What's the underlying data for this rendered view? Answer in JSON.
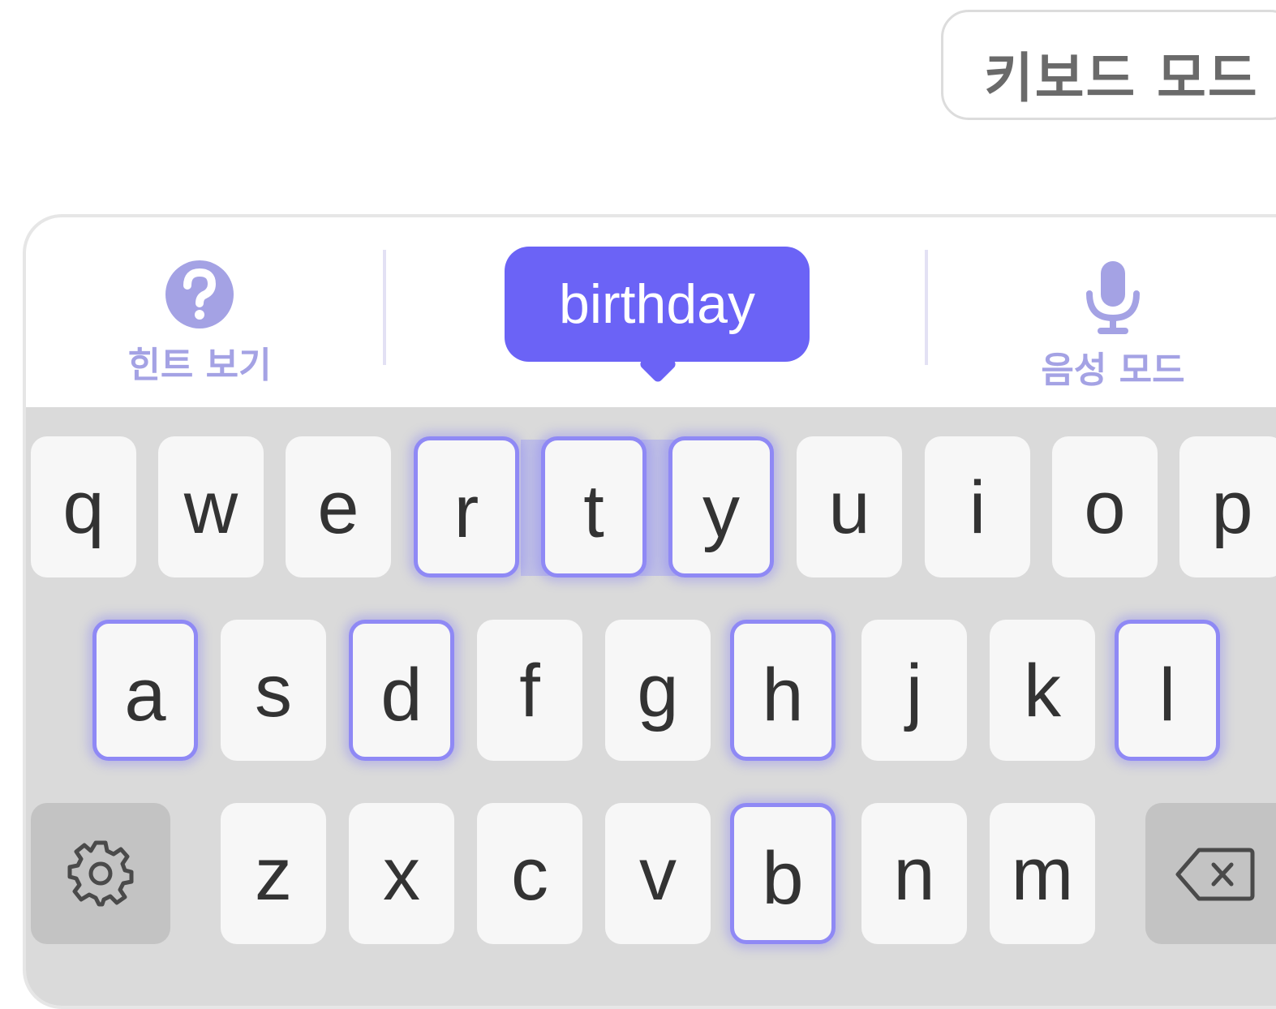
{
  "mode_button": {
    "label": "키보드 모드"
  },
  "toolbar": {
    "hint_label": "힌트 보기",
    "voice_label": "음성 모드",
    "suggestion": "birthday"
  },
  "keyboard": {
    "row1": [
      "q",
      "w",
      "e",
      "r",
      "t",
      "y",
      "u",
      "i",
      "o",
      "p"
    ],
    "row2": [
      "a",
      "s",
      "d",
      "f",
      "g",
      "h",
      "j",
      "k",
      "l"
    ],
    "row3": [
      "z",
      "x",
      "c",
      "v",
      "b",
      "n",
      "m"
    ],
    "highlighted_keys": [
      "r",
      "t",
      "y",
      "a",
      "d",
      "h",
      "l",
      "b"
    ],
    "settings_icon": "gear-icon",
    "backspace_icon": "backspace-icon"
  },
  "colors": {
    "accent": "#6b63f6",
    "highlight_border": "#8f89f5",
    "icon_tint": "#a4a2e4"
  }
}
